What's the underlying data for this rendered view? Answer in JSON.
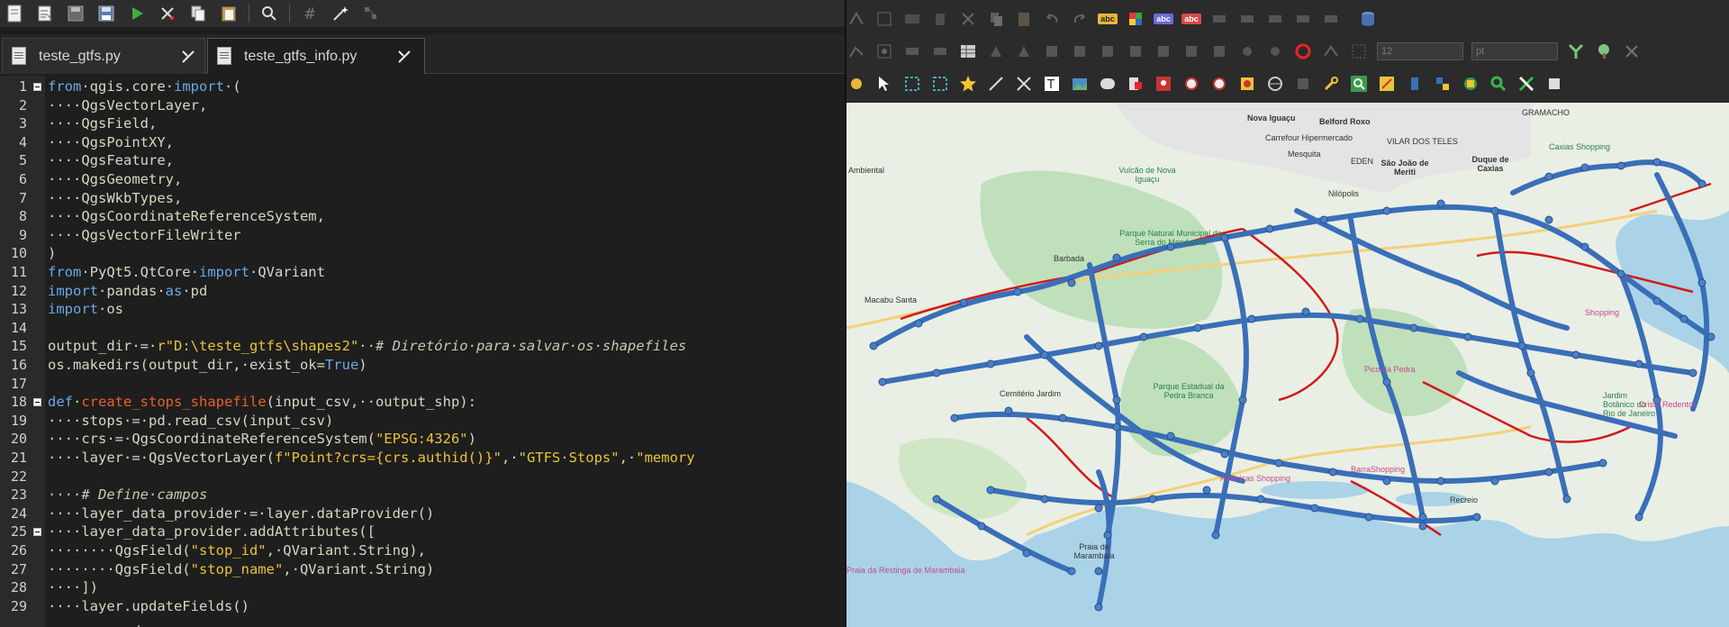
{
  "editor": {
    "tabs": [
      {
        "label": "teste_gtfs.py",
        "active": false
      },
      {
        "label": "teste_gtfs_info.py",
        "active": true
      }
    ],
    "line_numbers": [
      "1",
      "2",
      "3",
      "4",
      "5",
      "6",
      "7",
      "8",
      "9",
      "10",
      "11",
      "12",
      "13",
      "14",
      "15",
      "16",
      "17",
      "18",
      "19",
      "20",
      "21",
      "22",
      "23",
      "24",
      "25",
      "26",
      "27",
      "28",
      "29"
    ],
    "colors": {
      "keyword": "#6aa9e6",
      "function_name": "#e8602c",
      "string": "#e8c43a",
      "text": "#d6d6c4",
      "background": "#1e1e1e"
    },
    "lines": {
      "l1a": "from",
      "l1b": "·qgis.core·",
      "l1c": "import",
      "l1d": "·(",
      "l2": "····QgsVectorLayer,",
      "l3": "····QgsField,",
      "l4": "····QgsPointXY,",
      "l5": "····QgsFeature,",
      "l6": "····QgsGeometry,",
      "l7": "····QgsWkbTypes,",
      "l8": "····QgsCoordinateReferenceSystem,",
      "l9": "····QgsVectorFileWriter",
      "l10": ")",
      "l11a": "from",
      "l11b": "·PyQt5.QtCore·",
      "l11c": "import",
      "l11d": "·QVariant",
      "l12a": "import",
      "l12b": "·pandas·",
      "l12c": "as",
      "l12d": "·pd",
      "l13a": "import",
      "l13b": "·os",
      "l15a": "output_dir·=·",
      "l15b": "r\"D:\\teste_gtfs\\shapes2\"",
      "l15c": "··# Diretório·para·salvar·os·shapefiles",
      "l16a": "os.makedirs(output_dir,·exist_ok=",
      "l16b": "True",
      "l16c": ")",
      "l18a": "def",
      "l18b": "·",
      "l18c": "create_stops_shapefile",
      "l18d": "(input_csv,··output_shp):",
      "l19": "····stops·=·pd.read_csv(input_csv)",
      "l20a": "····crs·=·QgsCoordinateReferenceSystem(",
      "l20b": "\"EPSG:4326\"",
      "l20c": ")",
      "l21a": "····layer·=·QgsVectorLayer(",
      "l21b": "f\"Point?crs={crs.authid()}\"",
      "l21c": ",·",
      "l21d": "\"GTFS·Stops\"",
      "l21e": ",·",
      "l21f": "\"memory",
      "l23": "····# Define·campos",
      "l24": "····layer_data_provider·=·layer.dataProvider()",
      "l25": "····layer_data_provider.addAttributes([",
      "l26a": "········QgsField(",
      "l26b": "\"stop_id\"",
      "l26c": ",·QVariant.String),",
      "l27a": "········QgsField(",
      "l27b": "\"stop_name\"",
      "l27c": ",·QVariant.String)",
      "l28": "····])",
      "l29": "····layer.updateFields()"
    }
  },
  "qgis": {
    "spinbox_left": "12",
    "spinbox_right": "pt",
    "label_tool_abc": "abc",
    "map": {
      "colors": {
        "water": "#aad3e8",
        "land": "#e9efe4",
        "forest": "#bfe0ba",
        "urban": "#e4e4e4",
        "stops": "#3a6fb8",
        "routes": "#d11a1a"
      },
      "labels": {
        "nova_iguacu": "Nova Iguaçu",
        "belford_roxo": "Belford Roxo",
        "duque_de_caxias": "Duque de Caxias",
        "sao_joao_de_meriti": "São João de Meriti",
        "mesquita": "Mesquita",
        "nilopolis": "Nilópolis",
        "vilar_dos_teles": "VILAR DOS TELES",
        "eden": "EDEN",
        "pico_da_pedra": "Pico da Pedra",
        "parque_pedra_branca": "Parque Estadual da Pedra Branca",
        "praia_marambaia": "Praia de Marambaia",
        "cemiterio": "Cemitério Jardim",
        "ambiental": "Ambiental",
        "vulcao": "Vulcão de Nova Iguaçu",
        "carrefour": "Carrefour Hipermercado",
        "parque_natural": "Parque Natural Municipal da Serra do Mendanha",
        "caxias_shopping": "Caxias Shopping",
        "barbada": "Barbada",
        "macabu": "Macabu Santa",
        "americas": "Américas Shopping",
        "jardim_botanico": "Jardim Botânico do Rio de Janeiro",
        "recreio": "Recreio",
        "barra": "BarraShopping",
        "cristo": "Cristo Redentor",
        "shopping": "Shopping",
        "grumari": "Praia da Restinga de Marambaia",
        "gramacho": "GRAMACHO"
      }
    }
  }
}
